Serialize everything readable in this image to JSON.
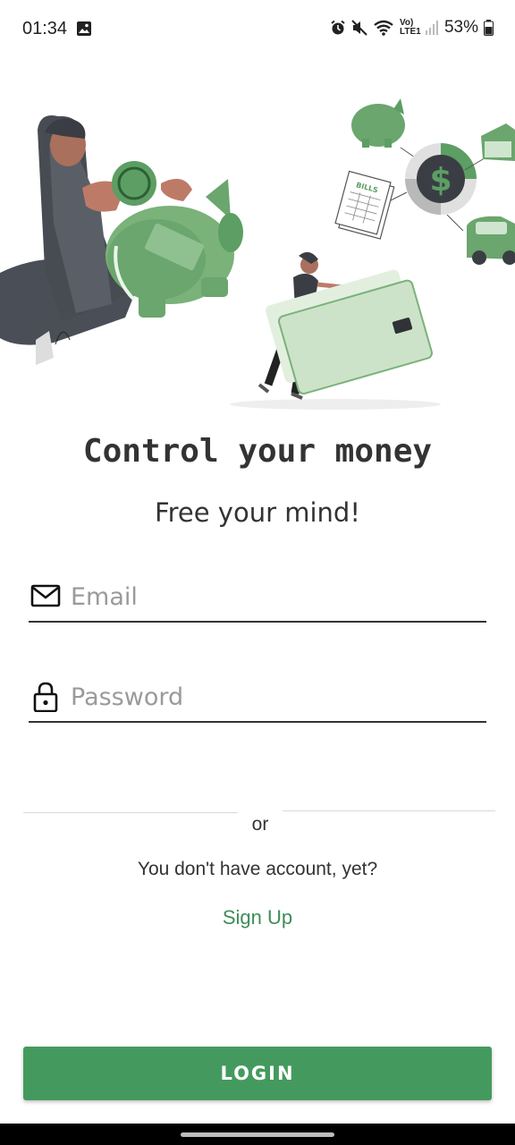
{
  "status_bar": {
    "time": "01:34",
    "battery": "53%",
    "network_label": "Vo) LTE1",
    "icons": [
      "gallery-icon",
      "alarm-icon",
      "mute-icon",
      "wifi-icon",
      "signal-icon",
      "battery-icon"
    ]
  },
  "illustration": {
    "bills_label": "BILLS",
    "accent_color": "#5c9e63"
  },
  "headline": "Control your money",
  "subheadline": "Free your mind!",
  "form": {
    "email": {
      "value": "",
      "placeholder": "Email",
      "icon": "mail-icon"
    },
    "password": {
      "value": "",
      "placeholder": "Password",
      "icon": "lock-icon"
    }
  },
  "separator_text": "or",
  "signup_prompt": "You don't have account, yet?",
  "signup_link": "Sign Up",
  "login_button": "LOGIN",
  "colors": {
    "primary": "#449a5e",
    "link": "#3d8d57",
    "text": "#333333"
  }
}
